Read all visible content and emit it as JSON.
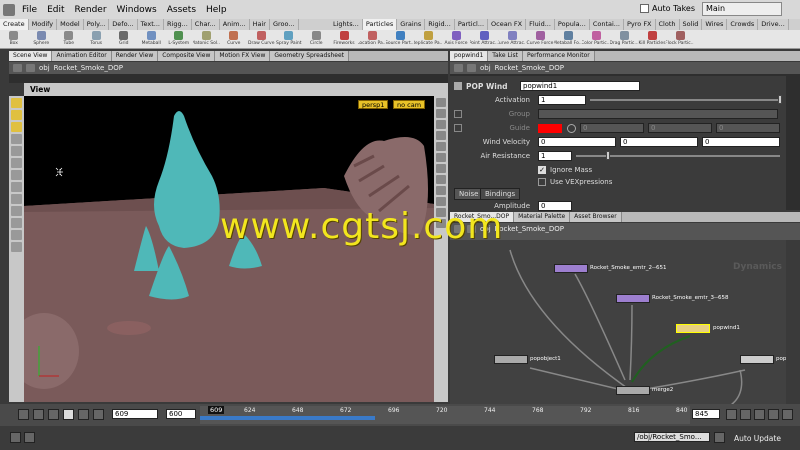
{
  "menubar": {
    "items": [
      "File",
      "Edit",
      "Render",
      "Windows",
      "Assets",
      "Help"
    ],
    "auto_takes": "Auto Takes",
    "take": "Main"
  },
  "shelf_left": {
    "tabs": [
      "Create",
      "Modify",
      "Model",
      "Poly...",
      "Defo...",
      "Text...",
      "Rigg...",
      "Char...",
      "Anim...",
      "Hair",
      "Groo..."
    ],
    "tools": [
      {
        "label": "Box",
        "color": "#8a8a8a"
      },
      {
        "label": "Sphere",
        "color": "#7a8ab0"
      },
      {
        "label": "Tube",
        "color": "#8a8a8a"
      },
      {
        "label": "Torus",
        "color": "#8aa0b0"
      },
      {
        "label": "Grid",
        "color": "#6a6a6a"
      },
      {
        "label": "Metaball",
        "color": "#7090c0"
      },
      {
        "label": "L-System",
        "color": "#509050"
      },
      {
        "label": "Platonic Sol...",
        "color": "#a0a070"
      },
      {
        "label": "Curve",
        "color": "#c07050"
      },
      {
        "label": "Draw Curve",
        "color": "#c06060"
      },
      {
        "label": "Spray Paint",
        "color": "#60a0c0"
      },
      {
        "label": "Circle",
        "color": "#888888"
      }
    ]
  },
  "shelf_right": {
    "tabs": [
      "Lights...",
      "Particles",
      "Grains",
      "Rigid...",
      "Particl...",
      "Ocean FX",
      "Fluid...",
      "Popula...",
      "Contai...",
      "Pyro FX",
      "Cloth",
      "Solid",
      "Wires",
      "Crowds",
      "Drive..."
    ],
    "tools": [
      {
        "label": "Fireworks",
        "color": "#c04040"
      },
      {
        "label": "Location Pa...",
        "color": "#c06060"
      },
      {
        "label": "Source Part...",
        "color": "#4080c0"
      },
      {
        "label": "Replicate Pa...",
        "color": "#c0a040"
      },
      {
        "label": "Axis Force",
        "color": "#8060c0"
      },
      {
        "label": "Point Attrac...",
        "color": "#6060c0"
      },
      {
        "label": "Curve Attrac...",
        "color": "#8080c0"
      },
      {
        "label": "Curve Force",
        "color": "#a060a0"
      },
      {
        "label": "Metaball Fo...",
        "color": "#6080a0"
      },
      {
        "label": "Color Partic...",
        "color": "#c060a0"
      },
      {
        "label": "Drag Partic...",
        "color": "#8090a0"
      },
      {
        "label": "Kill Particles",
        "color": "#c04040"
      },
      {
        "label": "Flock Partic...",
        "color": "#a06060"
      }
    ]
  },
  "left_panes": {
    "tabs": [
      "Scene View",
      "Animation Editor",
      "Render View",
      "Composite View",
      "Motion FX View",
      "Geometry Spreadsheet"
    ],
    "path_obj": "obj",
    "path_node": "Rocket_Smoke_DOP",
    "view_title": "View",
    "cam_menu": "persp1",
    "cam2_menu": "no cam"
  },
  "param_panes": {
    "tabs": [
      "popwind1",
      "Take List",
      "Performance Monitor"
    ],
    "path_obj": "obj",
    "path_node": "Rocket_Smoke_DOP"
  },
  "params": {
    "node_type": "POP Wind",
    "node_name": "popwind1",
    "activation_label": "Activation",
    "activation": "1",
    "group_label": "Group",
    "guide_label": "Guide",
    "guide_values": [
      "0",
      "0",
      "0"
    ],
    "wind_velocity_label": "Wind Velocity",
    "wind_velocity": [
      "0",
      "0",
      "0"
    ],
    "air_resistance_label": "Air Resistance",
    "air_resistance": "1",
    "ignore_mass": "Ignore Mass",
    "use_vex": "Use VEXpressions",
    "subtabs": [
      "Noise",
      "Bindings"
    ],
    "amplitude_label": "Amplitude",
    "amplitude": "0",
    "accent_red": "#ff0000"
  },
  "network": {
    "tabs": [
      "Rocket_Smo...DOP",
      "Material Palette",
      "Asset Browser"
    ],
    "path_obj": "obj",
    "path_node": "Rocket_Smoke_DOP",
    "context_label": "Dynamics",
    "nodes": [
      "Rocket_Smoke_emtr_2--651",
      "Rocket_Smoke_emtr_3--658",
      "popwind1",
      "popobject1",
      "merge2",
      "popinte"
    ]
  },
  "timeline": {
    "frame_field": "609",
    "start": "600",
    "current": "609",
    "ticks": [
      "624",
      "648",
      "672",
      "696",
      "720",
      "744",
      "768",
      "792",
      "816",
      "840"
    ],
    "end": "845"
  },
  "status": {
    "path": "/obj/Rocket_Smo...",
    "update_mode": "Auto Update"
  },
  "watermark": "www.cgtsj.com"
}
